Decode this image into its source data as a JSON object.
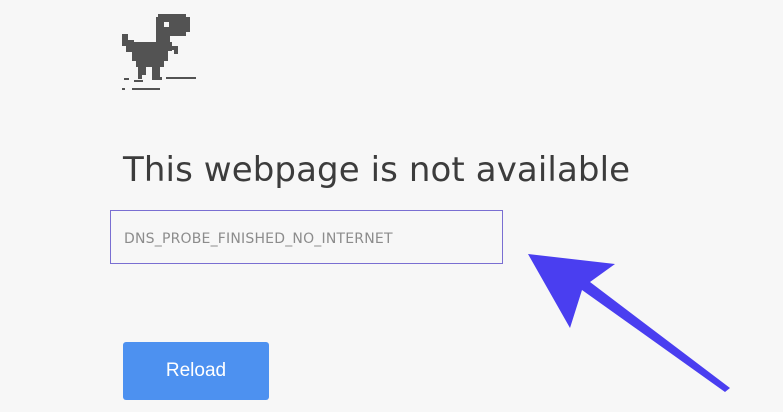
{
  "error_page": {
    "title": "This webpage is not available",
    "error_code": "DNS_PROBE_FINISHED_NO_INTERNET",
    "reload_label": "Reload"
  },
  "icons": {
    "dino": "dinosaur-icon",
    "annotation": "arrow-icon"
  },
  "colors": {
    "background": "#f7f7f7",
    "title_text": "#3c3c3c",
    "error_code_text": "#8c8c8c",
    "highlight_border": "#7a6fd2",
    "arrow": "#4a3ef0",
    "reload_button": "#4d91f0",
    "dino": "#535353"
  }
}
